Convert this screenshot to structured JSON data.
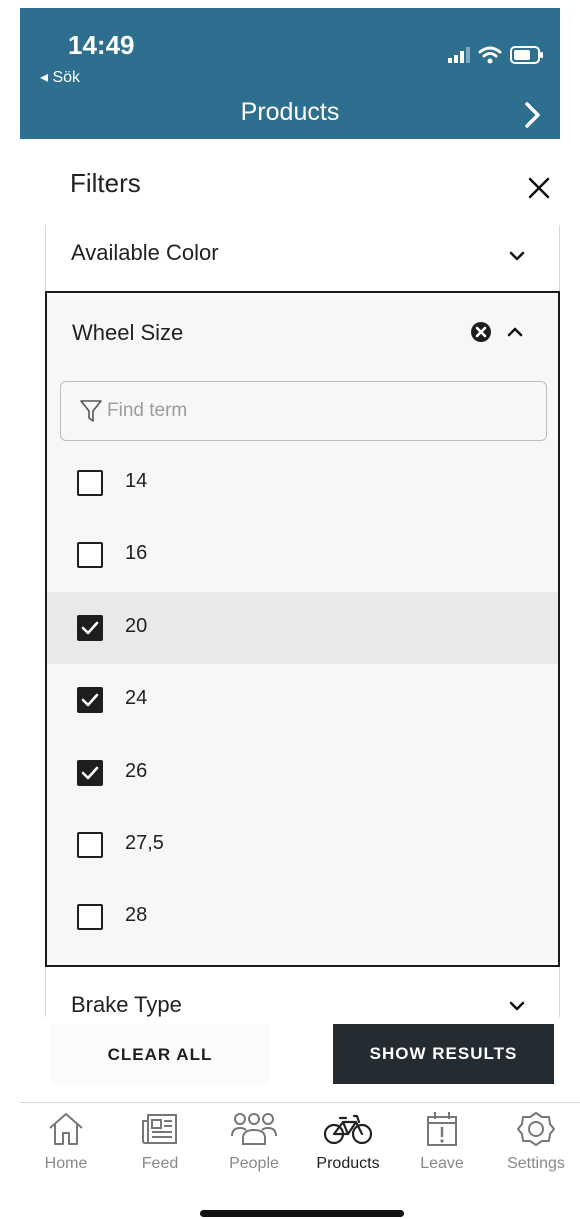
{
  "status_bar": {
    "time": "14:49",
    "back_app": "◂ Sök"
  },
  "nav": {
    "title": "Products"
  },
  "filters": {
    "title": "Filters",
    "sections": {
      "color": {
        "label": "Available Color",
        "expanded": false
      },
      "wheel_size": {
        "label": "Wheel Size",
        "expanded": true,
        "search_placeholder": "Find term",
        "search_value": "",
        "options": [
          {
            "label": "14",
            "checked": false
          },
          {
            "label": "16",
            "checked": false
          },
          {
            "label": "20",
            "checked": true,
            "highlighted": true
          },
          {
            "label": "24",
            "checked": true
          },
          {
            "label": "26",
            "checked": true
          },
          {
            "label": "27,5",
            "checked": false
          },
          {
            "label": "28",
            "checked": false
          }
        ]
      },
      "brake": {
        "label": "Brake Type",
        "expanded": false
      }
    },
    "clear_label": "CLEAR ALL",
    "show_label": "SHOW RESULTS"
  },
  "tabbar": {
    "items": [
      {
        "label": "Home",
        "icon": "home-icon"
      },
      {
        "label": "Feed",
        "icon": "newspaper-icon"
      },
      {
        "label": "People",
        "icon": "people-icon"
      },
      {
        "label": "Products",
        "icon": "bicycle-icon",
        "active": true
      },
      {
        "label": "Leave",
        "icon": "calendar-alert-icon"
      },
      {
        "label": "Settings",
        "icon": "gear-icon"
      }
    ]
  },
  "colors": {
    "header": "#2e6e8e",
    "primary_button": "#232b33",
    "checkbox": "#1e1e1e"
  }
}
